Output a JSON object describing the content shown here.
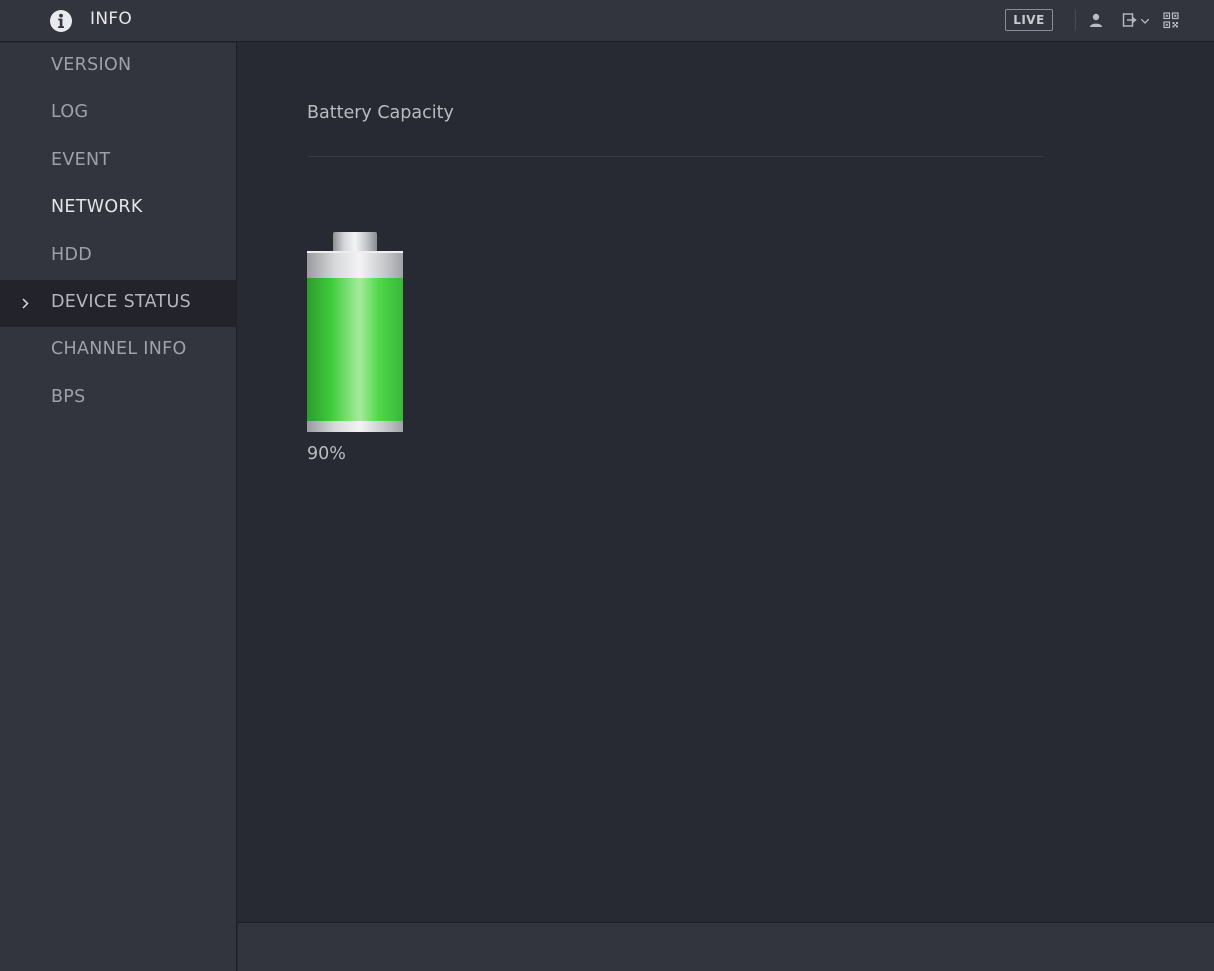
{
  "header": {
    "title": "INFO",
    "live_label": "LIVE",
    "icons": [
      "info-icon",
      "user-icon",
      "logout-icon",
      "qr-code-icon"
    ]
  },
  "sidebar": {
    "items": [
      {
        "label": "VERSION"
      },
      {
        "label": "LOG"
      },
      {
        "label": "EVENT"
      },
      {
        "label": "NETWORK"
      },
      {
        "label": "HDD"
      },
      {
        "label": "DEVICE STATUS",
        "selected": true
      },
      {
        "label": "CHANNEL INFO"
      },
      {
        "label": "BPS"
      }
    ]
  },
  "main": {
    "section_title": "Battery Capacity",
    "battery": {
      "level": 0.9,
      "percent_label": "90%"
    }
  },
  "colors": {
    "background": "#282a33",
    "panel": "#32343e",
    "selected_item": "#23242b",
    "battery_green": "#38c23a"
  }
}
